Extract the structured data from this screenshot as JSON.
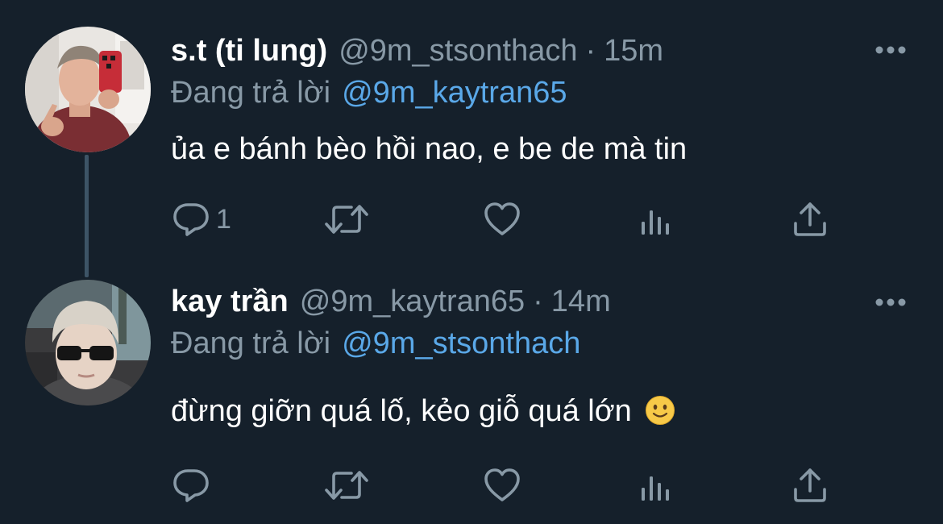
{
  "tweets": [
    {
      "display_name": "s.t (ti lung)",
      "handle": "@9m_stsonthach",
      "separator": "·",
      "time": "15m",
      "reply_prefix": "Đang trả lời",
      "reply_mention": "@9m_kaytran65",
      "text": "ủa e bánh bèo hồi nao, e be de mà tin",
      "reply_count": "1",
      "icons": [
        "reply-icon",
        "retweet-icon",
        "like-icon",
        "views-icon",
        "share-icon",
        "more-icon"
      ]
    },
    {
      "display_name": "kay trần",
      "handle": "@9m_kaytran65",
      "separator": "·",
      "time": "14m",
      "reply_prefix": "Đang trả lời",
      "reply_mention": "@9m_stsonthach",
      "text": "đừng giỡn quá lố, kẻo giỗ quá lớn",
      "text_emoji": "slightly-smiling-face",
      "reply_count": "",
      "icons": [
        "reply-icon",
        "retweet-icon",
        "like-icon",
        "views-icon",
        "share-icon",
        "more-icon"
      ]
    }
  ],
  "colors": {
    "background": "#15202b",
    "text_primary": "#ffffff",
    "text_secondary": "#8899a6",
    "mention": "#5aa8e8",
    "thread_line": "#3d5466"
  }
}
